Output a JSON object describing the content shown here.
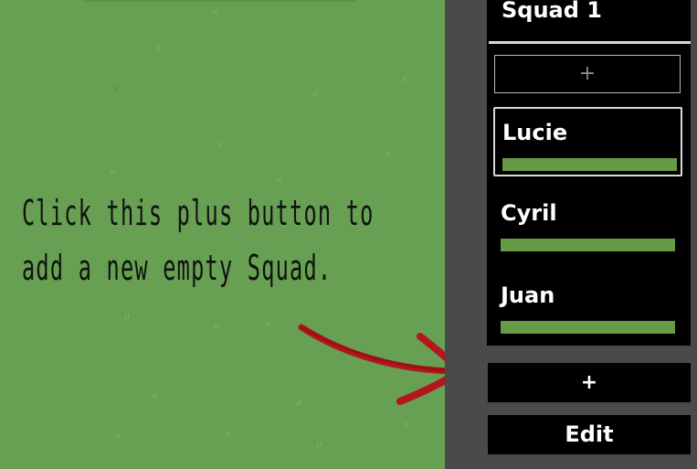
{
  "tutorial": {
    "line1": "Click this plus button to",
    "line2": "add a new empty Squad."
  },
  "squad_list": {
    "title": "Squad 1",
    "add_member_label": "+",
    "members": [
      {
        "name": "Lucie",
        "selected": true
      },
      {
        "name": "Cyril",
        "selected": false
      },
      {
        "name": "Juan",
        "selected": false
      }
    ]
  },
  "buttons": {
    "add_squad_label": "+",
    "edit_label": "Edit"
  },
  "colors": {
    "grass": "#67a052",
    "panel": "#4a4a4a",
    "member_bar": "#669a46",
    "arrow": "#b3161d"
  }
}
